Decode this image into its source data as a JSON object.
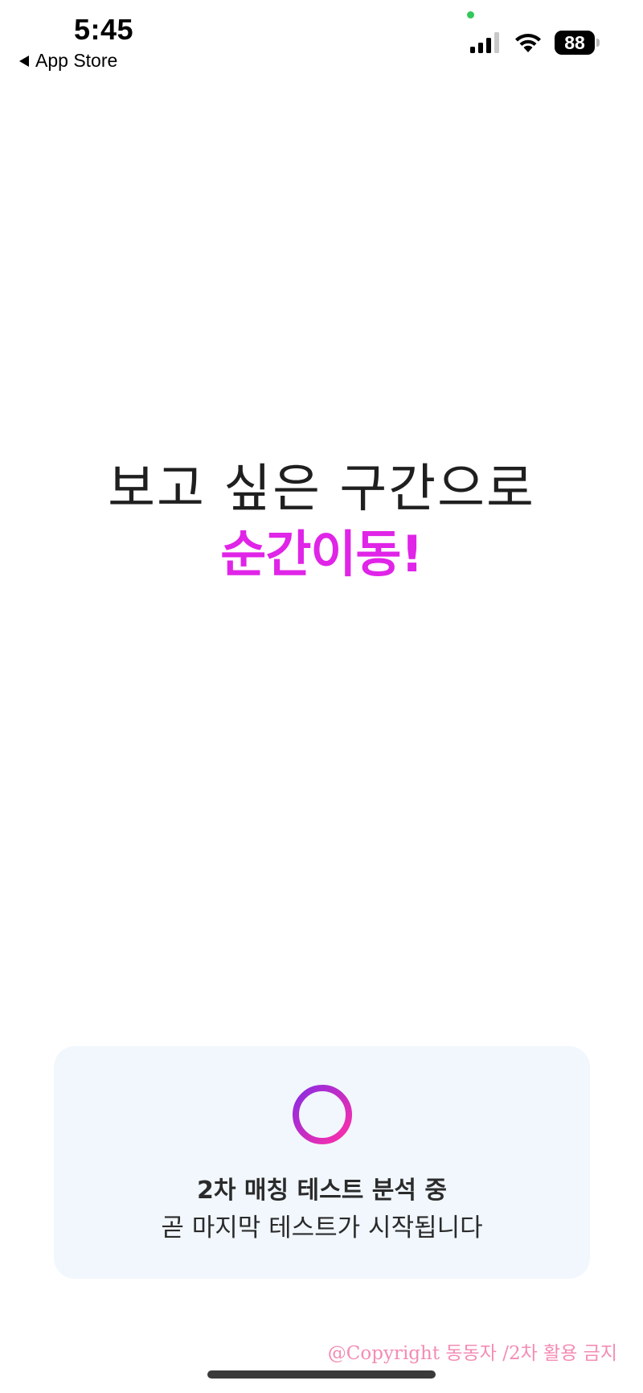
{
  "status_bar": {
    "time": "5:45",
    "back_label": "App Store",
    "battery_level": "88",
    "privacy_dot_color": "#34c759"
  },
  "hero": {
    "line1": "보고 싶은 구간으로",
    "line2": "순간이동!",
    "accent_color": "#e024e8"
  },
  "loading_card": {
    "title": "2차 매칭 테스트 분석 중",
    "subtitle": "곧 마지막 테스트가 시작됩니다",
    "spinner_icon": "loading-ring-icon",
    "spinner_gradient": [
      "#8a2be2",
      "#ff2fa8"
    ]
  },
  "watermark": {
    "text": "@Copyright 동동자 /2차 활용 금지"
  }
}
